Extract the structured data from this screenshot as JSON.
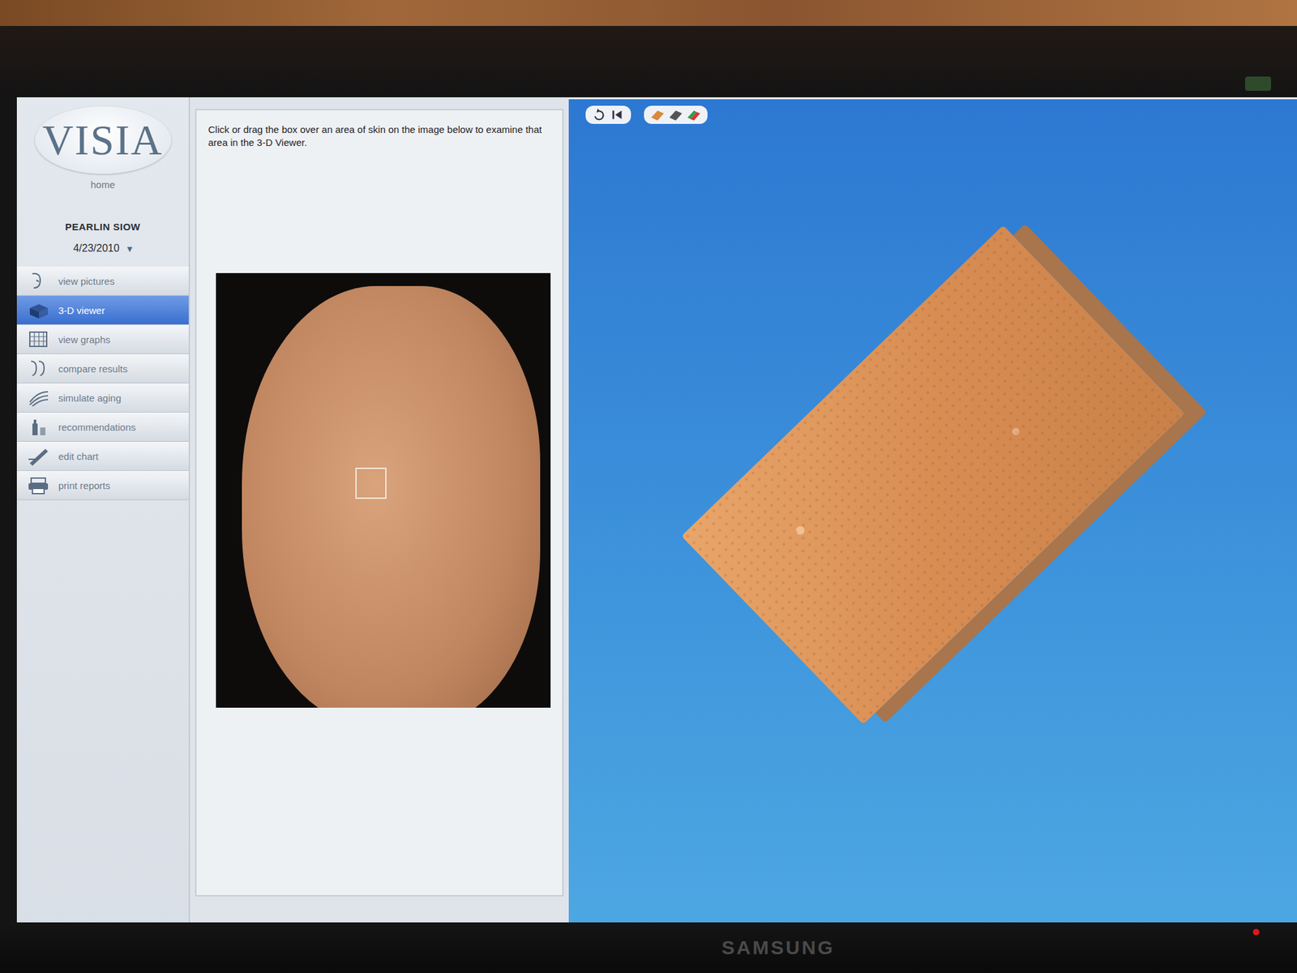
{
  "app": {
    "logo": "VISIA",
    "home": "home"
  },
  "client": {
    "name": "PEARLIN SIOW",
    "date": "4/23/2010",
    "dropdown": "▾"
  },
  "menu": [
    {
      "label": "view pictures",
      "selected": false
    },
    {
      "label": "3-D viewer",
      "selected": true
    },
    {
      "label": "view graphs",
      "selected": false
    },
    {
      "label": "compare results",
      "selected": false
    },
    {
      "label": "simulate aging",
      "selected": false
    },
    {
      "label": "recommendations",
      "selected": false
    },
    {
      "label": "edit chart",
      "selected": false
    },
    {
      "label": "print reports",
      "selected": false
    }
  ],
  "instruction": "Click or drag the box over an area of skin on the image below to examine that area in the 3-D Viewer.",
  "monitor": {
    "brand": "SAMSUNG"
  }
}
